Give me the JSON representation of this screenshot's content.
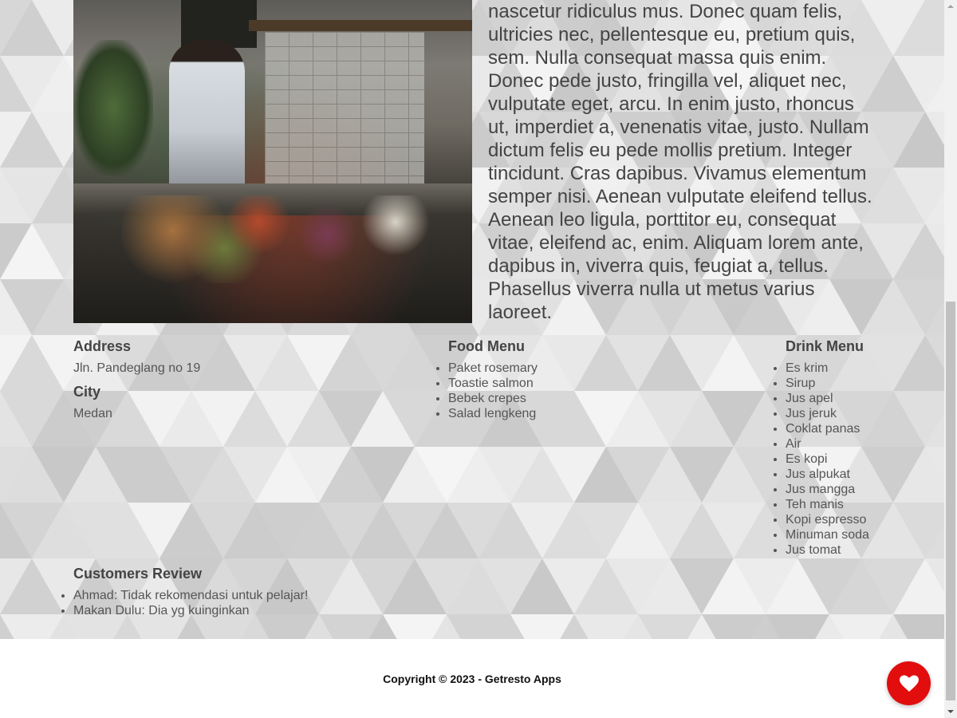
{
  "intro": {
    "text": "nascetur ridiculus mus. Donec quam felis, ultricies nec, pellentesque eu, pretium quis, sem. Nulla consequat massa quis enim. Donec pede justo, fringilla vel, aliquet nec, vulputate eget, arcu. In enim justo, rhoncus ut, imperdiet a, venenatis vitae, justo. Nullam dictum felis eu pede mollis pretium. Integer tincidunt. Cras dapibus. Vivamus elementum semper nisi. Aenean vulputate eleifend tellus. Aenean leo ligula, porttitor eu, consequat vitae, eleifend ac, enim. Aliquam lorem ante, dapibus in, viverra quis, feugiat a, tellus. Phasellus viverra nulla ut metus varius laoreet."
  },
  "info": {
    "address_heading": "Address",
    "address": "Jln. Pandeglang no 19",
    "city_heading": "City",
    "city": "Medan"
  },
  "food_menu": {
    "heading": "Food Menu",
    "items": [
      "Paket rosemary",
      "Toastie salmon",
      "Bebek crepes",
      "Salad lengkeng"
    ]
  },
  "drink_menu": {
    "heading": "Drink Menu",
    "items": [
      "Es krim",
      "Sirup",
      "Jus apel",
      "Jus jeruk",
      "Coklat panas",
      "Air",
      "Es kopi",
      "Jus alpukat",
      "Jus mangga",
      "Teh manis",
      "Kopi espresso",
      "Minuman soda",
      "Jus tomat"
    ]
  },
  "reviews": {
    "heading": "Customers Review",
    "items": [
      "Ahmad: Tidak rekomendasi untuk pelajar!",
      "Makan Dulu: Dia yg kuinginkan"
    ]
  },
  "footer": {
    "copyright": "Copyright © 2023 - Getresto Apps"
  },
  "favorite_button": {
    "icon": "heart-icon",
    "color": "#e20d0d"
  },
  "colors": {
    "background": "#e4e4e4",
    "text": "#444444",
    "accent": "#e20d0d"
  }
}
